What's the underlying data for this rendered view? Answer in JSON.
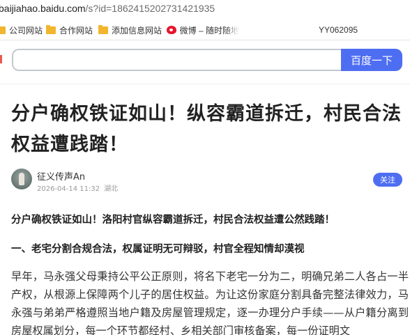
{
  "browser": {
    "url_host": "baijiahao.baidu.com",
    "url_path": "/s?id=1862415202731421935"
  },
  "bookmarks": {
    "items": [
      {
        "label": "公司网站",
        "icon": "folder-icon"
      },
      {
        "label": "合作网站",
        "icon": "folder-icon"
      },
      {
        "label": "添加信息网站",
        "icon": "folder-icon"
      },
      {
        "label": "微博 – 随时随地",
        "icon": "weibo-icon"
      }
    ],
    "right_text": "YY062095"
  },
  "search": {
    "value": "",
    "button_label": "百度一下"
  },
  "article": {
    "title": "分户确权铁证如山！纵容霸道拆迁，村民合法权益遭践踏！",
    "author": {
      "name": "征义传声An",
      "datetime": "2026-04-14 11:32",
      "location": "湖北",
      "follow_label": "关注"
    },
    "lead": "分户确权铁证如山！洛阳村官纵容霸道拆迁，村民合法权益遭公然践踏！",
    "heading1": "一、老宅分割合规合法，权属证明无可辩驳，村官全程知情却漠视",
    "paragraph1": "早年，马永强父母秉持公平公正原则，将名下老宅一分为二，明确兄弟二人各占一半产权，从根源上保障两个儿子的居住权益。为让这份家庭分割具备完整法律效力，马永强与弟弟严格遵照当地户籍及房屋管理规定，逐一办理分户手续——从户籍分离到房屋权属划分，每一个环节都经村、乡相关部门审核备案，每一份证明文"
  },
  "colors": {
    "accent": "#4e6ef2",
    "folder": "#f2b52e",
    "weibo": "#e6162d"
  }
}
